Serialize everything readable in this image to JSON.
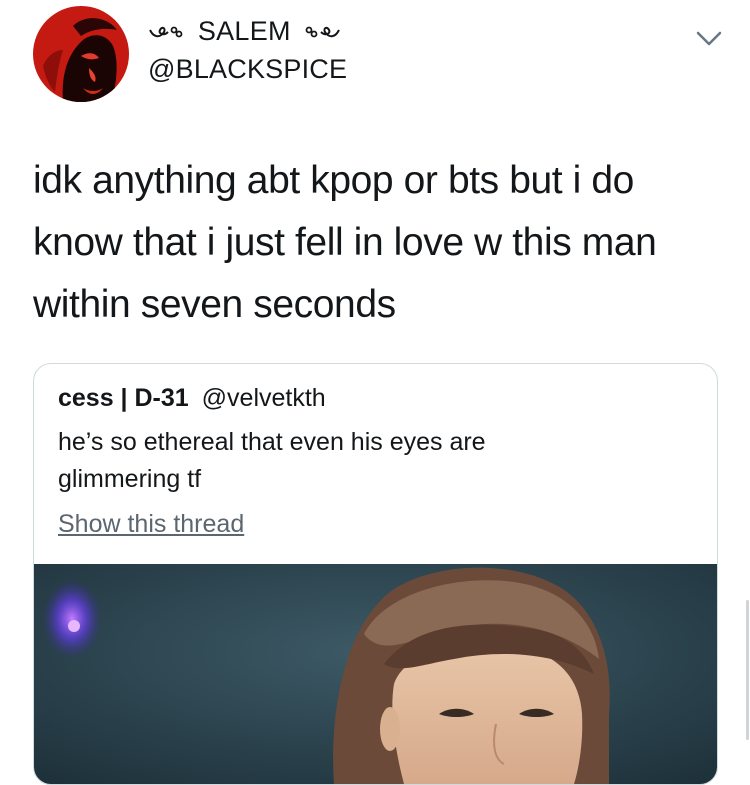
{
  "tweet": {
    "display_name": "𝄑 SALEM 𝄑",
    "display_name_text": "SALEM",
    "handle": "@BLACKSPICE",
    "avatar_icon": "profile-avatar",
    "menu_icon": "chevron-down-icon",
    "text_lines": [
      "idk anything abt kpop or bts but i do",
      "know that i just fell in love w this man",
      "within seven seconds"
    ]
  },
  "quoted_tweet": {
    "name": "cess | D-31",
    "handle": "@velvetkth",
    "text_lines": [
      "he’s so ethereal that even his eyes are",
      "glimmering tf"
    ],
    "show_thread_label": "Show this thread",
    "media_icon": "video-thumbnail"
  },
  "colors": {
    "text": "#14171a",
    "border": "#cfd9de",
    "link": "#5b6670",
    "media_bg": "#2f4a55"
  }
}
